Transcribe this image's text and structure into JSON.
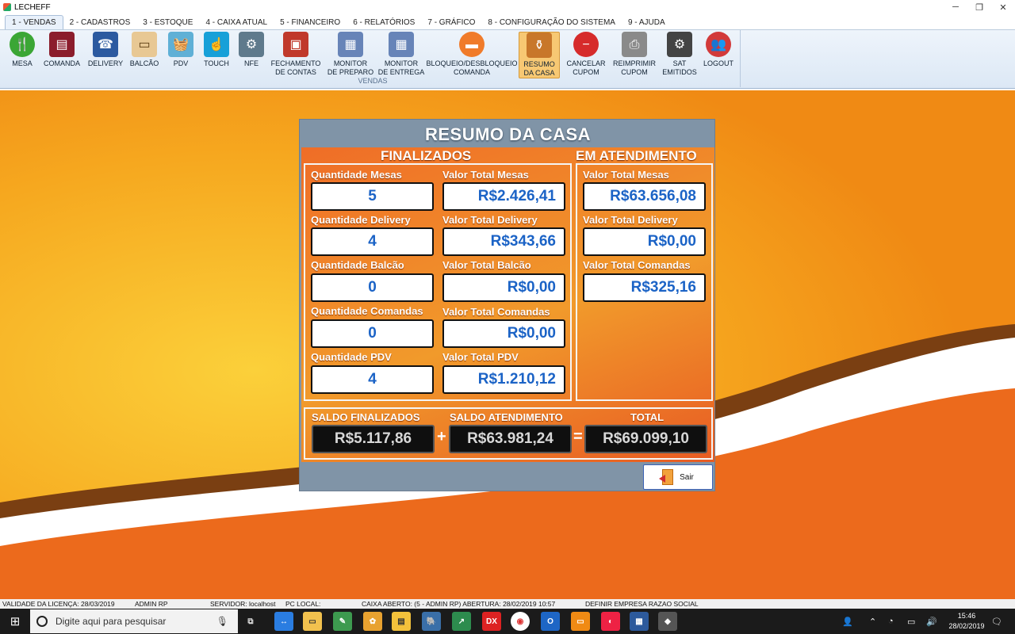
{
  "window": {
    "title": "LECHEFF",
    "minimize": "─",
    "maximize": "❐",
    "close": "✕"
  },
  "menu": {
    "tabs": [
      "1 - VENDAS",
      "2 - CADASTROS",
      "3 - ESTOQUE",
      "4 - CAIXA ATUAL",
      "5 - FINANCEIRO",
      "6 - RELATÓRIOS",
      "7 - GRÁFICO",
      "8 - CONFIGURAÇÃO DO SISTEMA",
      "9 - AJUDA"
    ]
  },
  "ribbon": {
    "group_label": "VENDAS",
    "buttons": [
      {
        "label": "MESA",
        "icon": "fork-knife-icon"
      },
      {
        "label": "COMANDA",
        "icon": "comanda-icon"
      },
      {
        "label": "DELIVERY",
        "icon": "phone-icon"
      },
      {
        "label": "BALCÃO",
        "icon": "counter-icon"
      },
      {
        "label": "PDV",
        "icon": "basket-icon"
      },
      {
        "label": "TOUCH",
        "icon": "touch-screen-icon"
      },
      {
        "label": "NFE",
        "icon": "gears-icon"
      },
      {
        "label": "FECHAMENTO\nDE CONTAS",
        "icon": "register-icon"
      },
      {
        "label": "MONITOR\nDE PREPARO",
        "icon": "monitor-prep-icon"
      },
      {
        "label": "MONITOR\nDE ENTREGA",
        "icon": "monitor-delivery-icon"
      },
      {
        "label": "BLOQUEIO/DESBLOQUEIO\nCOMANDA",
        "icon": "lock-card-icon"
      },
      {
        "label": "RESUMO\nDA CASA",
        "icon": "jar-icon"
      },
      {
        "label": "CANCELAR\nCUPOM",
        "icon": "cancel-icon"
      },
      {
        "label": "REIMPRIMIR\nCUPOM",
        "icon": "printer-icon"
      },
      {
        "label": "SAT\nEMITIDOS",
        "icon": "sat-icon"
      },
      {
        "label": "LOGOUT",
        "icon": "users-icon"
      }
    ]
  },
  "modal": {
    "title": "RESUMO DA CASA",
    "finalizados": {
      "title": "FINALIZADOS",
      "rows": [
        {
          "qty_label": "Quantidade Mesas",
          "qty": "5",
          "val_label": "Valor Total Mesas",
          "val": "R$2.426,41"
        },
        {
          "qty_label": "Quantidade Delivery",
          "qty": "4",
          "val_label": "Valor Total Delivery",
          "val": "R$343,66"
        },
        {
          "qty_label": "Quantidade Balcão",
          "qty": "0",
          "val_label": "Valor Total Balcão",
          "val": "R$0,00"
        },
        {
          "qty_label": "Quantidade Comandas",
          "qty": "0",
          "val_label": "Valor Total Comandas",
          "val": "R$0,00"
        },
        {
          "qty_label": "Quantidade PDV",
          "qty": "4",
          "val_label": "Valor Total PDV",
          "val": "R$1.210,12"
        }
      ]
    },
    "atendimento": {
      "title": "EM ATENDIMENTO",
      "rows": [
        {
          "label": "Valor Total Mesas",
          "val": "R$63.656,08"
        },
        {
          "label": "Valor Total Delivery",
          "val": "R$0,00"
        },
        {
          "label": "Valor Total Comandas",
          "val": "R$325,16"
        }
      ]
    },
    "totals": {
      "saldo_finalizados_label": "SALDO FINALIZADOS",
      "saldo_finalizados": "R$5.117,86",
      "plus": "+",
      "saldo_atendimento_label": "SALDO ATENDIMENTO",
      "saldo_atendimento": "R$63.981,24",
      "equals": "=",
      "total_label": "TOTAL",
      "total": "R$69.099,10"
    },
    "sair_label": "Sair"
  },
  "status": {
    "licenca": "VALIDADE DA LICENÇA: 28/03/2019",
    "user": "ADMIN RP",
    "servidor": "SERVIDOR: localhost",
    "pc": "PC LOCAL:",
    "caixa": "CAIXA ABERTO: (5 - ADMIN RP) ABERTURA: 28/02/2019 10:57",
    "empresa": "DEFINIR EMPRESA RAZAO SOCIAL"
  },
  "taskbar": {
    "search_placeholder": "Digite aqui para pesquisar",
    "time": "15:46",
    "date": "28/02/2019"
  }
}
